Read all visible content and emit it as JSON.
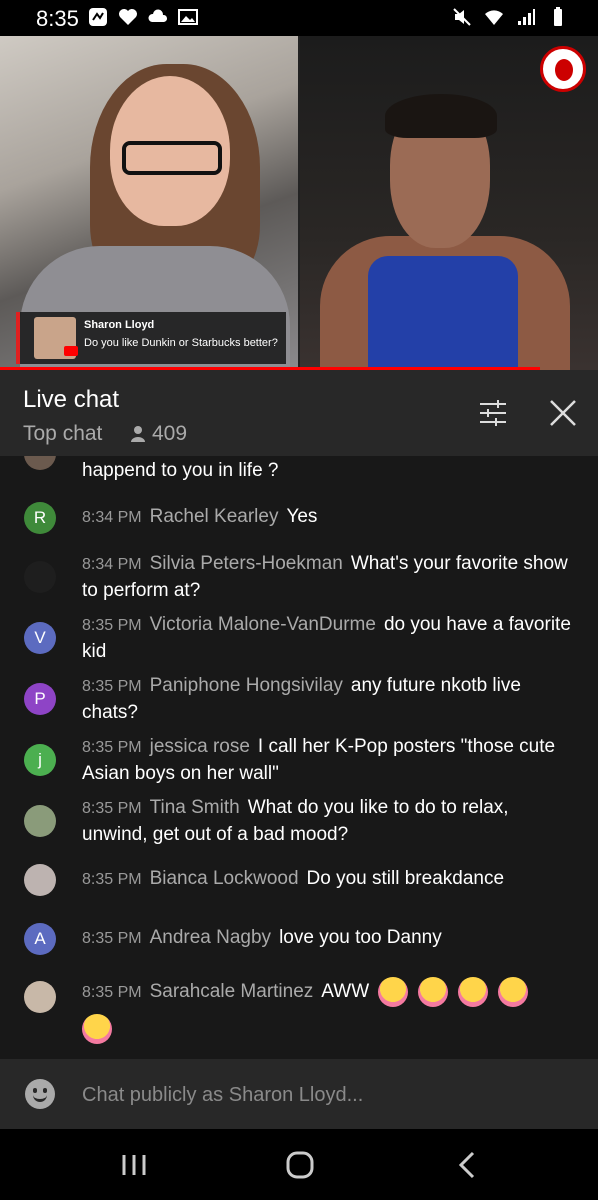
{
  "status_bar": {
    "time": "8:35"
  },
  "video": {
    "lower_third": {
      "name": "Sharon Lloyd",
      "message": "Do you like Dunkin or Starbucks better?"
    }
  },
  "chat_header": {
    "title": "Live chat",
    "mode": "Top chat",
    "viewer_count": "409"
  },
  "messages": [
    {
      "time": "",
      "author": "",
      "text": "happend to you in life ?",
      "avatar_letter": "",
      "avatar_color": "#6b5a4e"
    },
    {
      "time": "8:34 PM",
      "author": "Rachel Kearley",
      "text": "Yes",
      "avatar_letter": "R",
      "avatar_color": "#3f8a3a"
    },
    {
      "time": "8:34 PM",
      "author": "Silvia Peters-Hoekman",
      "text": "What's your favorite show to perform at?",
      "avatar_letter": "",
      "avatar_color": "#1e1e1e"
    },
    {
      "time": "8:35 PM",
      "author": "Victoria Malone-VanDurme",
      "text": "do you have a favorite kid",
      "avatar_letter": "V",
      "avatar_color": "#5c6bc0"
    },
    {
      "time": "8:35 PM",
      "author": "Paniphone Hongsivilay",
      "text": "any future nkotb live chats?",
      "avatar_letter": "P",
      "avatar_color": "#8e44c6"
    },
    {
      "time": "8:35 PM",
      "author": "jessica rose",
      "text": "I call her K-Pop posters \"those cute Asian boys on her wall\"",
      "avatar_letter": "j",
      "avatar_color": "#4caf50"
    },
    {
      "time": "8:35 PM",
      "author": "Tina Smith",
      "text": "What do you like to do to relax, unwind, get out of a bad mood?",
      "avatar_letter": "",
      "avatar_color": "#8a9b7a"
    },
    {
      "time": "8:35 PM",
      "author": "Bianca Lockwood",
      "text": "Do you still breakdance",
      "avatar_letter": "",
      "avatar_color": "#bdb3b0"
    },
    {
      "time": "8:35 PM",
      "author": "Andrea Nagby",
      "text": "love you too Danny",
      "avatar_letter": "A",
      "avatar_color": "#5c6bc0"
    },
    {
      "time": "8:35 PM",
      "author": "Sarahcale Martinez",
      "text": "AWW",
      "avatar_letter": "",
      "avatar_color": "#c8b8a8",
      "emoji_count": 5
    }
  ],
  "input": {
    "placeholder": "Chat publicly as Sharon Lloyd..."
  }
}
